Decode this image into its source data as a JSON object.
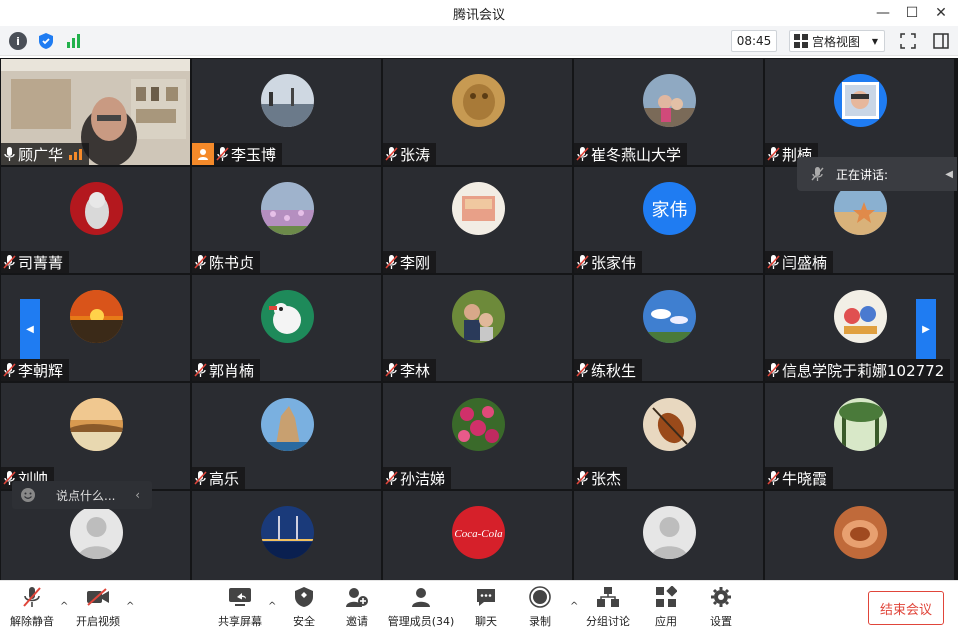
{
  "window": {
    "title": "腾讯会议"
  },
  "topbar": {
    "time": "08:45",
    "view_label": "宫格视图"
  },
  "speaking": {
    "label": "正在讲话:"
  },
  "chat": {
    "placeholder": "说点什么..."
  },
  "participants": [
    {
      "name": "顾广华"
    },
    {
      "name": "李玉博"
    },
    {
      "name": "张涛"
    },
    {
      "name": "崔冬燕山大学"
    },
    {
      "name": "荆楠"
    },
    {
      "name": "司菁菁"
    },
    {
      "name": "陈书贞"
    },
    {
      "name": "李刚"
    },
    {
      "name": "张家伟",
      "avatar_text": "家伟"
    },
    {
      "name": "闫盛楠"
    },
    {
      "name": "李朝辉"
    },
    {
      "name": "郭肖楠"
    },
    {
      "name": "李林"
    },
    {
      "name": "练秋生"
    },
    {
      "name": "信息学院于莉娜102772"
    },
    {
      "name": "刘帅"
    },
    {
      "name": "高乐"
    },
    {
      "name": "孙洁娣"
    },
    {
      "name": "张杰"
    },
    {
      "name": "牛晓霞"
    },
    {
      "name": ""
    },
    {
      "name": ""
    },
    {
      "name": ""
    },
    {
      "name": ""
    },
    {
      "name": ""
    }
  ],
  "bottombar": {
    "unmute": "解除静音",
    "start_video": "开启视频",
    "share_screen": "共享屏幕",
    "security": "安全",
    "invite": "邀请",
    "manage_members": "管理成员(34)",
    "chat": "聊天",
    "record": "录制",
    "breakout": "分组讨论",
    "apps": "应用",
    "settings": "设置",
    "end_meeting": "结束会议"
  },
  "colors": {
    "accent": "#1f7cf2",
    "end": "#e0453a",
    "tile": "#2a2c31"
  }
}
